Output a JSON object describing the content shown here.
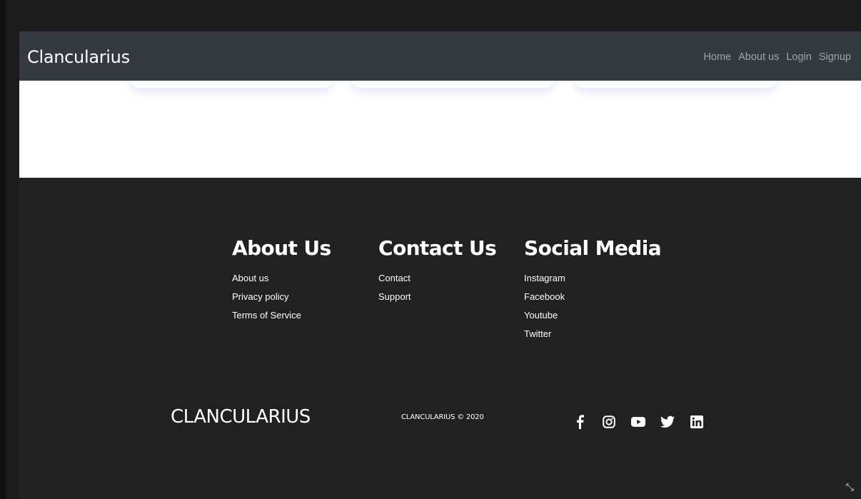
{
  "navbar": {
    "brand": "Clancularius",
    "links": [
      "Home",
      "About us",
      "Login",
      "Signup"
    ]
  },
  "footer": {
    "columns": [
      {
        "title": "About Us",
        "items": [
          "About us",
          "Privacy policy",
          "Terms of Service"
        ]
      },
      {
        "title": "Contact Us",
        "items": [
          "Contact",
          "Support"
        ]
      },
      {
        "title": "Social Media",
        "items": [
          "Instagram",
          "Facebook",
          "Youtube",
          "Twitter"
        ]
      }
    ],
    "brand": "CLANCULARIUS",
    "copyright": "CLANCULARIUS © 2020",
    "social_icons": [
      "facebook-icon",
      "instagram-icon",
      "youtube-icon",
      "twitter-icon",
      "linkedin-icon"
    ]
  },
  "colors": {
    "navbar_bg": "#343a40",
    "footer_bg": "#212121",
    "nav_link": "#9ea4aa",
    "text": "#ffffff"
  }
}
